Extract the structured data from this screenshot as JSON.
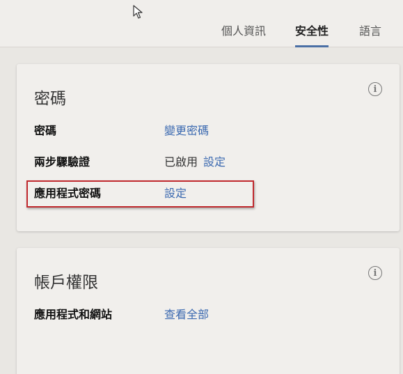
{
  "tabs": [
    {
      "label": "個人資訊",
      "active": false
    },
    {
      "label": "安全性",
      "active": true
    },
    {
      "label": "語言",
      "active": false
    }
  ],
  "password_card": {
    "title": "密碼",
    "info_icon": "info-icon",
    "rows": [
      {
        "label": "密碼",
        "link": "變更密碼"
      },
      {
        "label": "兩步驟驗證",
        "status": "已啟用",
        "link": "設定"
      },
      {
        "label": "應用程式密碼",
        "link": "設定"
      }
    ]
  },
  "permissions_card": {
    "title": "帳戶權限",
    "info_icon": "info-icon",
    "rows": [
      {
        "label": "應用程式和網站",
        "link": "查看全部"
      }
    ]
  },
  "colors": {
    "link": "#3b69b0",
    "active_tab_underline": "#4a6fa5",
    "highlight_border": "#c0282d"
  }
}
